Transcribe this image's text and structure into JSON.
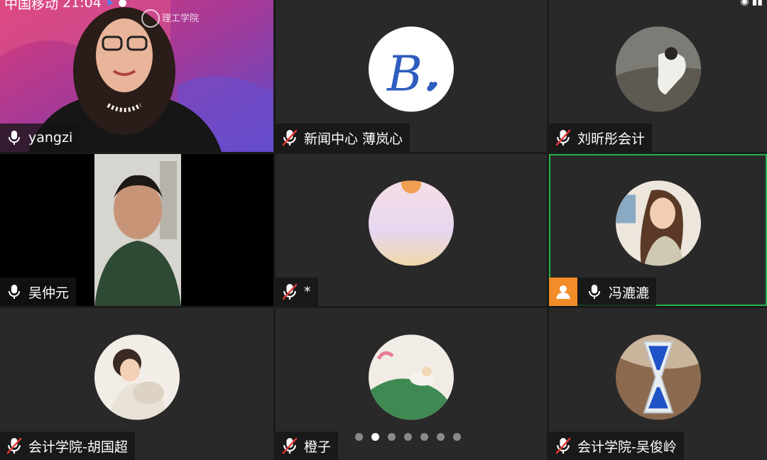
{
  "status_bar": {
    "carrier": "中国移动",
    "time": "21:04"
  },
  "participants": [
    {
      "name": "yangzi",
      "mic": "on"
    },
    {
      "name": "新闻中心  薄岚心",
      "mic": "muted",
      "avatar_text": "B."
    },
    {
      "name": "刘昕彤会计",
      "mic": "muted"
    },
    {
      "name": "吴仲元",
      "mic": "on"
    },
    {
      "name": "*",
      "mic": "muted"
    },
    {
      "name": "冯漉漉",
      "mic": "on",
      "active_speaker": true
    },
    {
      "name": "会计学院-胡国超",
      "mic": "muted"
    },
    {
      "name": "橙子",
      "mic": "muted"
    },
    {
      "name": "会计学院-吴俊岭",
      "mic": "muted"
    }
  ],
  "pager": {
    "pages": 7,
    "current": 2
  },
  "colors": {
    "tile_bg": "#292929",
    "active_border": "#27b24a",
    "muted_red": "#e53935",
    "person_badge": "#f28c28"
  }
}
